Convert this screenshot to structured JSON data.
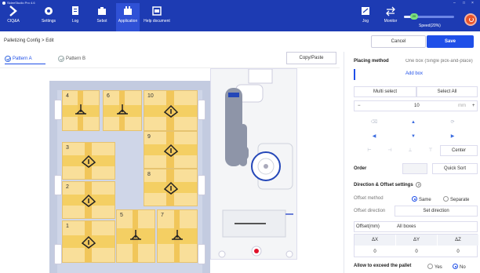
{
  "app": {
    "title": "SideeStudio Pro 4.6",
    "window_controls": [
      "–",
      "□",
      "×"
    ]
  },
  "nav": {
    "items": [
      {
        "label": "CIQ&A",
        "icon": "chevron-right-icon"
      },
      {
        "label": "Settings",
        "icon": "gear-icon"
      },
      {
        "label": "Log",
        "icon": "log-icon"
      },
      {
        "label": "Sebot",
        "icon": "puzzle-icon"
      },
      {
        "label": "Application",
        "icon": "application-icon",
        "active": true
      },
      {
        "label": "Help document",
        "icon": "help-document-icon"
      }
    ],
    "right": [
      {
        "label": "Jog",
        "icon": "jog-icon"
      },
      {
        "label": "Monitor",
        "icon": "monitor-icon"
      }
    ],
    "speed_label": "Speed(20%)",
    "speed_value": 0.2,
    "speed_thumb_text": "20"
  },
  "header": {
    "breadcrumb": "Palletizing Config > Edit",
    "cancel_label": "Cancel",
    "save_label": "Save"
  },
  "patterns": {
    "tabs": [
      {
        "label": "Pattern A",
        "active": true
      },
      {
        "label": "Pattern B",
        "active": false
      }
    ],
    "copy_paste_label": "Copy/Paste"
  },
  "layout": {
    "boxes": [
      {
        "num": "4"
      },
      {
        "num": "6"
      },
      {
        "num": "10"
      },
      {
        "num": "3"
      },
      {
        "num": "9"
      },
      {
        "num": "8"
      },
      {
        "num": "2"
      },
      {
        "num": "1"
      },
      {
        "num": "5"
      },
      {
        "num": "7"
      }
    ]
  },
  "panel": {
    "placing_method_label": "Placing method",
    "placing_method_value": "One box (Single pick-and-place)",
    "add_box_label": "Add box",
    "multi_select_label": "Multi select",
    "select_all_label": "Select All",
    "minus_label": "−",
    "step_value": "10",
    "step_unit": "mm",
    "plus_label": "+",
    "center_label": "Center",
    "order_label": "Order",
    "quick_sort_label": "Quick Sort",
    "dir_offset_label": "Direction & Offset settings",
    "help_label": "?",
    "offset_method_label": "Offset method",
    "offset_same_label": "Same",
    "offset_separate_label": "Separate",
    "offset_direction_label": "Offset direction",
    "set_direction_label": "Set direction",
    "offset_mm_label": "Offset(mm)",
    "all_boxes_label": "All boxes",
    "table_headers": [
      "ΔX",
      "ΔY",
      "ΔZ"
    ],
    "table_values": [
      "0",
      "0",
      "0"
    ],
    "exceed_label": "Allow to exceed the pallet",
    "yes_label": "Yes",
    "no_label": "No"
  }
}
